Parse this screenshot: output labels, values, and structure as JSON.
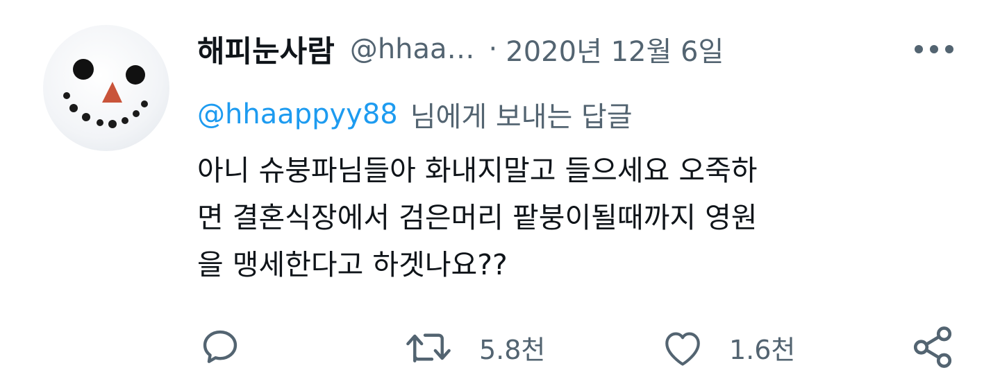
{
  "tweet": {
    "author_name": "해피눈사람",
    "author_handle": "@hhaa…",
    "separator": "·",
    "date": "2020년 12월 6일",
    "reply_to_handle": "@hhaappyy88",
    "reply_to_suffix": "님에게 보내는 답글",
    "text_lines": [
      "아니 슈붕파님들아 화내지말고 들으세요 오죽하",
      "면 결혼식장에서 검은머리 팥붕이될때까지 영원",
      "을 맹세한다고 하겟나요??"
    ]
  },
  "actions": {
    "retweet_count": "5.8천",
    "like_count": "1.6천"
  },
  "icons": {
    "avatar": "snowman-face-avatar",
    "more": "more-icon",
    "reply": "reply-icon",
    "retweet": "retweet-icon",
    "like": "heart-icon",
    "share": "share-icon"
  },
  "colors": {
    "text": "#0f1419",
    "secondary": "#536471",
    "link": "#1d9bf0"
  }
}
